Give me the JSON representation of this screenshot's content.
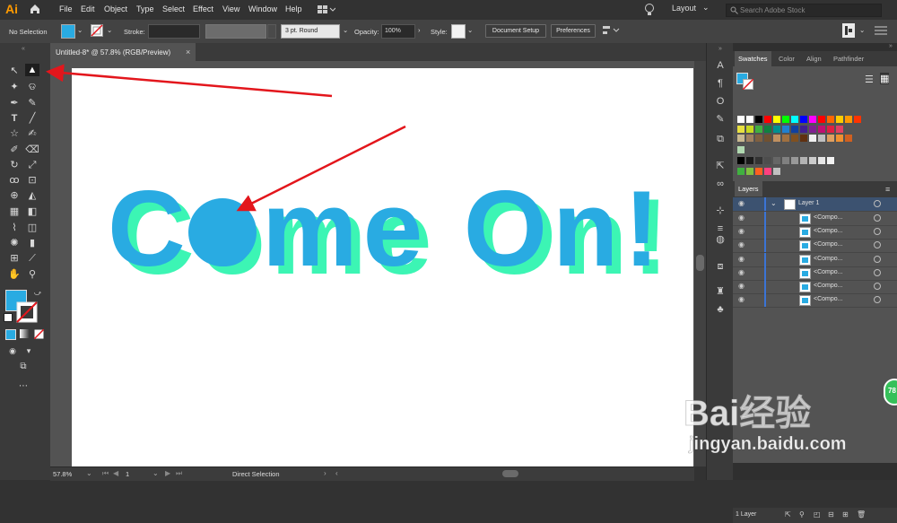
{
  "app": {
    "logo": "Ai"
  },
  "menu": [
    "File",
    "Edit",
    "Object",
    "Type",
    "Select",
    "Effect",
    "View",
    "Window",
    "Help"
  ],
  "workspace": {
    "label": "Layout"
  },
  "search": {
    "placeholder": "Search Adobe Stock"
  },
  "control": {
    "selection": "No Selection",
    "stroke_label": "Stroke:",
    "brush": "3 pt. Round",
    "opacity_label": "Opacity:",
    "opacity_value": "100%",
    "style_label": "Style:",
    "doc_setup": "Document Setup",
    "preferences": "Preferences"
  },
  "document_tab": {
    "title": "Untitled-8* @ 57.8% (RGB/Preview)",
    "close": "×"
  },
  "artwork": {
    "text": "Come On!",
    "fill": "#29abe2",
    "shadow": "#3cf5b4"
  },
  "status": {
    "zoom": "57.8%",
    "artboard_num": "1",
    "tool": "Direct Selection"
  },
  "panels": {
    "tabs": [
      "Swatches",
      "Color",
      "Align",
      "Pathfinder"
    ],
    "layers_title": "Layers",
    "layer_name": "Layer 1",
    "sublayers": [
      "<Compo...",
      "<Compo...",
      "<Compo...",
      "<Compo...",
      "<Compo...",
      "<Compo...",
      "<Compo..."
    ],
    "layers_count": "1 Layer"
  },
  "colors": {
    "fill_swatch": "#29abe2",
    "arrow": "#e3161c"
  },
  "watermark": {
    "brand": "Bai经验",
    "url": "jingyan.baidu.com"
  },
  "badge": {
    "value": "78"
  }
}
